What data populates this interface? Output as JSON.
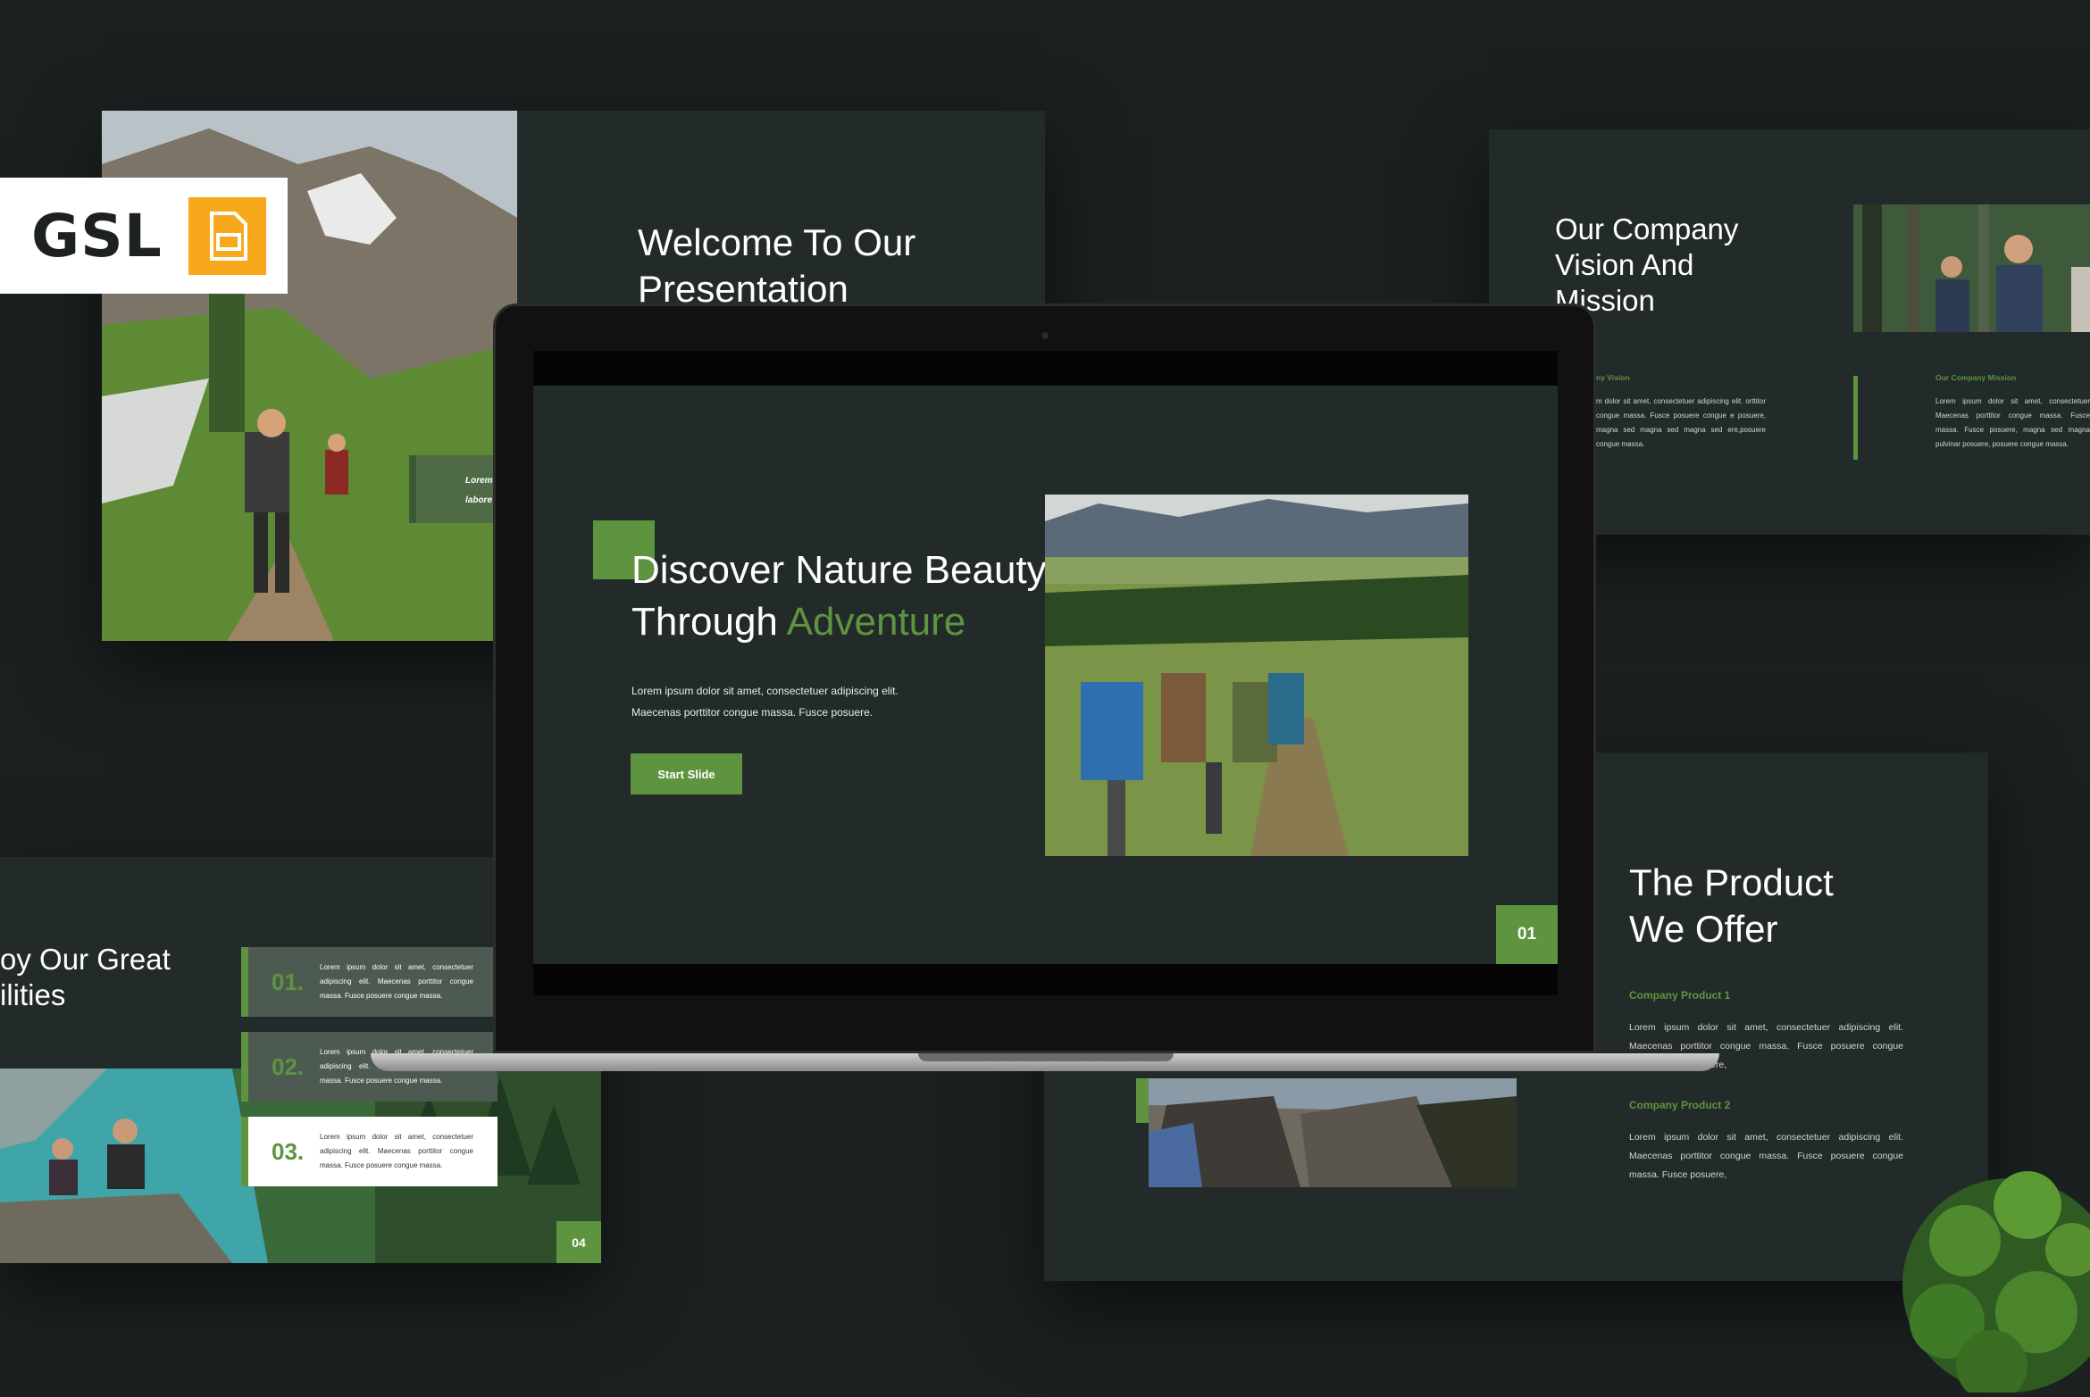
{
  "badge": {
    "label": "GSL",
    "icon": "google-slides-icon",
    "icon_color": "#f7a81b"
  },
  "colors": {
    "background": "#1b2020",
    "slide": "#232b2a",
    "accent": "#5e9440"
  },
  "slide_welcome": {
    "title_line1": "Welcome To Our",
    "title_line2": "Presentation",
    "caption_line1": "Lorem",
    "caption_line2": "labore"
  },
  "slide_vision": {
    "title_line1": "Our Company",
    "title_line2": "Vision And",
    "title_line3": "Mission",
    "vision_head": "ny Vision",
    "vision_body": "m dolor sit amet, consectetuer adipiscing elit. orttitor congue massa. Fusce posuere congue e posuere, magna sed magna sed magna sed ere,posuere congue massa.",
    "mission_head": "Our Company Mission",
    "mission_body": "Lorem ipsum dolor sit amet, consectetuer Maecenas porttitor congue massa. Fusce massa. Fusce posuere, magna sed magna pulvinar posuere, posuere congue massa."
  },
  "slide_facilities": {
    "title_line1": "oy Our Great",
    "title_line2": "ilities",
    "items": [
      {
        "num": "01.",
        "text": "Lorem ipsum dolor sit amet, consectetuer adipiscing elit. Maecenas porttitor congue massa. Fusce posuere congue massa."
      },
      {
        "num": "02.",
        "text": "Lorem ipsum dolor sit amet, consectetuer adipiscing elit. Maecenas porttitor congue massa. Fusce posuere congue massa."
      },
      {
        "num": "03.",
        "text": "Lorem ipsum dolor sit amet, consectetuer adipiscing elit. Maecenas porttitor congue massa. Fusce posuere congue massa."
      }
    ],
    "page_num": "04"
  },
  "slide_product": {
    "title_line1": "The Product",
    "title_line2": "We Offer",
    "product1_head": "Company Product 1",
    "product1_body": "Lorem ipsum dolor sit amet, consectetuer adipiscing elit. Maecenas porttitor congue massa. Fusce posuere congue massa. Fusce posuere,",
    "product2_head": "Company Product 2",
    "product2_body": "Lorem ipsum dolor sit amet, consectetuer adipiscing elit. Maecenas porttitor congue massa. Fusce posuere congue massa. Fusce posuere,"
  },
  "main_slide": {
    "title_line1": "Discover Nature Beauty",
    "title_line2_prefix": "Through ",
    "title_line2_accent": "Adventure",
    "body_line1": "Lorem ipsum dolor sit amet, consectetuer adipiscing elit.",
    "body_line2": "Maecenas porttitor congue massa. Fusce posuere.",
    "button_label": "Start Slide",
    "page_num": "01"
  }
}
